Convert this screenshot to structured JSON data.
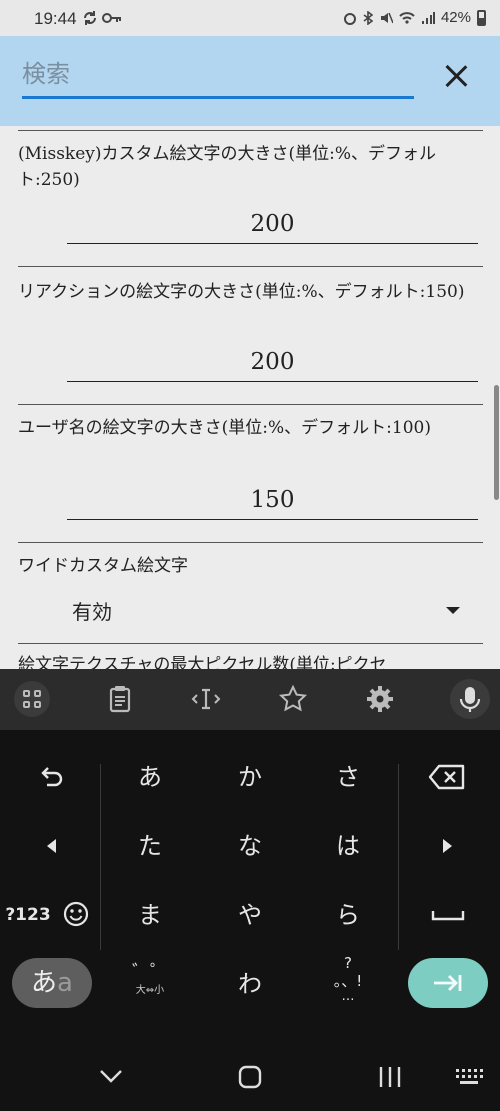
{
  "status_bar": {
    "time": "19:44",
    "battery": "42%"
  },
  "search": {
    "placeholder": "検索"
  },
  "settings": [
    {
      "label": "(Misskey)カスタム絵文字の大きさ(単位:%、デフォルト:250)",
      "value": "200"
    },
    {
      "label": "リアクションの絵文字の大きさ(単位:%、デフォルト:150)",
      "value": "200"
    },
    {
      "label": "ユーザ名の絵文字の大きさ(単位:%、デフォルト:100)",
      "value": "150"
    },
    {
      "label": "ワイドカスタム絵文字",
      "select_value": "有効"
    },
    {
      "label": "絵文字テクスチャの最大ピクセル数(単位:ピクセ"
    }
  ],
  "keyboard_toolbar": {
    "icons": [
      "apps-grid-icon",
      "clipboard-icon",
      "cursor-move-icon",
      "star-icon",
      "gear-icon",
      "mic-icon"
    ]
  },
  "keyboard": {
    "rows": [
      [
        "あ",
        "か",
        "さ"
      ],
      [
        "た",
        "な",
        "は"
      ],
      [
        "ま",
        "や",
        "ら"
      ],
      [
        "",
        "わ",
        ""
      ]
    ],
    "num_label": "?123",
    "dakuten_label": "大⇔小",
    "mode_label_main": "あ",
    "mode_label_sub": "a",
    "punct_top": "?",
    "punct_bottom": "。、!",
    "punct_dots": "…"
  },
  "colors": {
    "search_bg": "#b3d6f0",
    "search_underline": "#1978d0",
    "enter_key": "#7ecdc2"
  }
}
